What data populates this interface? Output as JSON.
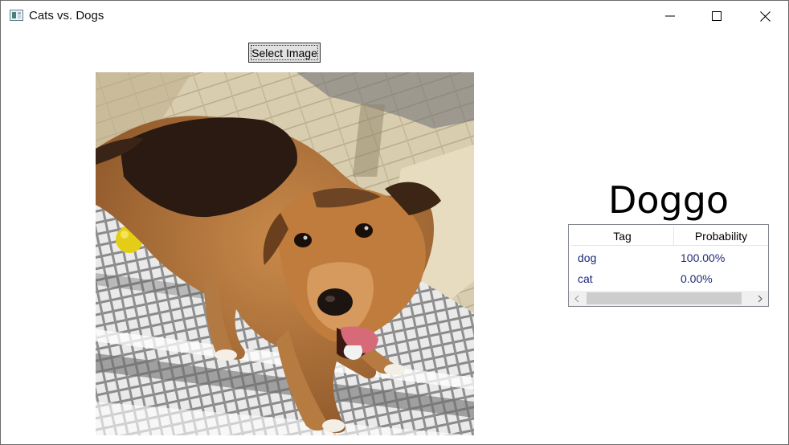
{
  "window": {
    "title": "Cats vs. Dogs",
    "icon": "app-window-icon",
    "controls": [
      "minimize-icon",
      "maximize-icon",
      "close-icon"
    ]
  },
  "toolbar": {
    "select_image_label": "Select Image"
  },
  "image": {
    "description_icon": "photo",
    "colors": {
      "dog_fur": "#b0743b",
      "dog_dark": "#2a1a12",
      "ball": "#e9d21a",
      "tongue": "#d76a78"
    }
  },
  "prediction": {
    "label": "Doggo"
  },
  "results": {
    "columns": [
      "Tag",
      "Probability"
    ],
    "rows": [
      {
        "tag": "dog",
        "probability": "100.00%"
      },
      {
        "tag": "cat",
        "probability": "0.00%"
      }
    ],
    "row_text_color": "#1f2a7a"
  }
}
